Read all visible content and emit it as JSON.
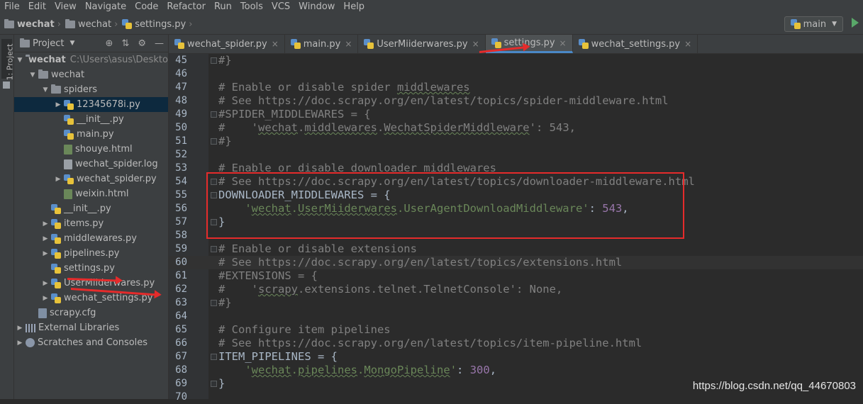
{
  "menu": [
    "File",
    "Edit",
    "View",
    "Navigate",
    "Code",
    "Refactor",
    "Run",
    "Tools",
    "VCS",
    "Window",
    "Help"
  ],
  "breadcrumb": [
    "wechat",
    "wechat",
    "settings.py"
  ],
  "run_config": {
    "label": "main"
  },
  "sidebar_strip": {
    "label": "1: Project"
  },
  "project_panel": {
    "title": "Project",
    "tree": [
      {
        "label": "wechat",
        "path": "C:\\Users\\asus\\Desktop"
      },
      {
        "label": "wechat"
      },
      {
        "label": "spiders"
      },
      {
        "label": "12345678i.py"
      },
      {
        "label": "__init__.py"
      },
      {
        "label": "main.py"
      },
      {
        "label": "shouye.html"
      },
      {
        "label": "wechat_spider.log"
      },
      {
        "label": "wechat_spider.py"
      },
      {
        "label": "weixin.html"
      },
      {
        "label": "__init__.py"
      },
      {
        "label": "items.py"
      },
      {
        "label": "middlewares.py"
      },
      {
        "label": "pipelines.py"
      },
      {
        "label": "settings.py"
      },
      {
        "label": "UserMiiderwares.py"
      },
      {
        "label": "wechat_settings.py"
      },
      {
        "label": "scrapy.cfg"
      },
      {
        "label": "External Libraries"
      },
      {
        "label": "Scratches and Consoles"
      }
    ]
  },
  "tabs": [
    "wechat_spider.py",
    "main.py",
    "UserMiiderwares.py",
    "settings.py",
    "wechat_settings.py"
  ],
  "code": {
    "line_numbers": [
      "45",
      "46",
      "47",
      "48",
      "49",
      "50",
      "51",
      "52",
      "53",
      "54",
      "55",
      "56",
      "57",
      "58",
      "59",
      "60",
      "61",
      "62",
      "63",
      "64",
      "65",
      "66",
      "67",
      "68",
      "69",
      "70"
    ],
    "l45": "#}",
    "l47a": "# Enable or disable spider ",
    "l47b": "middlewares",
    "l48": "# See https://doc.scrapy.org/en/latest/topics/spider-middleware.html",
    "l49": "#SPIDER_MIDDLEWARES = {",
    "l50a": "#    '",
    "l50b": "wechat",
    "l50c": ".",
    "l50d": "middlewares",
    "l50e": ".",
    "l50f": "WechatSpiderMiddleware",
    "l50g": "': 543,",
    "l51": "#}",
    "l53": "# Enable or disable downloader middlewares",
    "l54": "# See https://doc.scrapy.org/en/latest/topics/downloader-middleware.html",
    "l55a": "DOWNLOADER_MIDDLEWARES",
    " l55b": " = {",
    "l56a": "    '",
    "l56b": "wechat",
    "l56c": ".",
    "l56d": "UserMiiderwares",
    "l56e": ".UserAgentDownloadMiddleware'",
    "l56f": ": ",
    "l56g": "543",
    "l56h": ",",
    "l57": "}",
    "l59": "# Enable or disable extensions",
    "l60": "# See https://doc.scrapy.org/en/latest/topics/extensions.html",
    "l61": "#EXTENSIONS = {",
    "l62a": "#    '",
    "l62b": "scrapy",
    "l62c": ".extensions.telnet.TelnetConsole': None,",
    "l63": "#}",
    "l65": "# Configure item pipelines",
    "l66": "# See https://doc.scrapy.org/en/latest/topics/item-pipeline.html",
    "l67a": "ITEM_PIPELINES",
    "l67b": " = {",
    "l68a": "    '",
    "l68b": "wechat",
    "l68c": ".",
    "l68d": "pipelines",
    "l68e": ".",
    "l68f": "MongoPipeline",
    "l68g": "'",
    "l68h": ": ",
    "l68i": "300",
    "l68j": ",",
    "l69": "}"
  },
  "watermark": "https://blog.csdn.net/qq_44670803",
  "colors": {
    "comment": "#808080",
    "string": "#6a8759",
    "number": "#9876aa",
    "annotation": "#e52b2b"
  }
}
